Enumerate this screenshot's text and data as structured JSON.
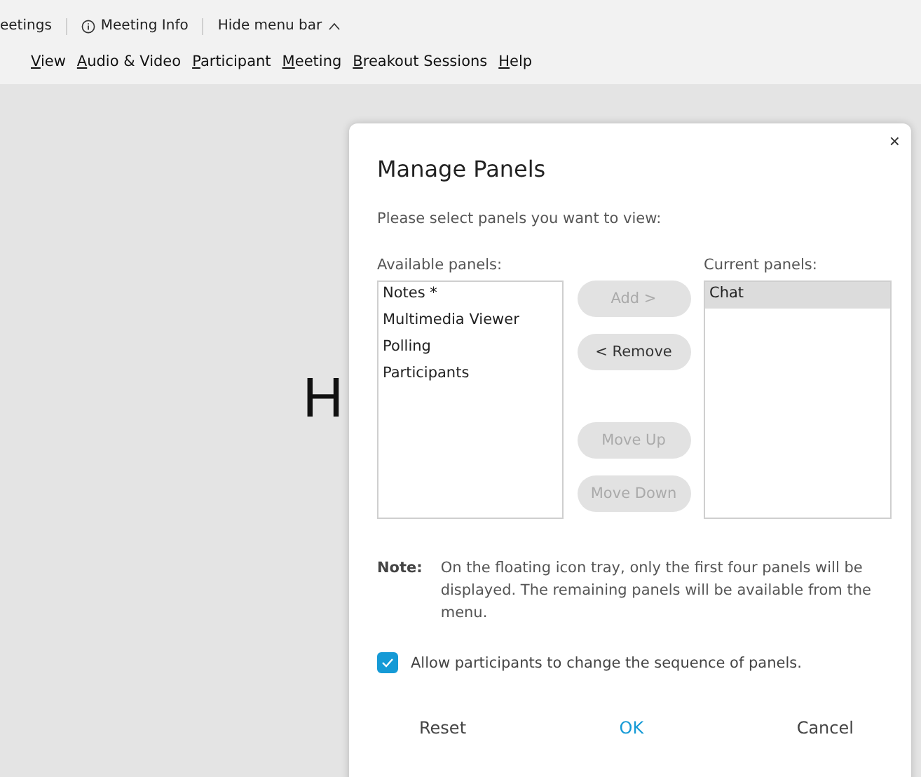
{
  "toolbar": {
    "items": [
      {
        "kind": "text",
        "label": "eetings"
      },
      {
        "kind": "info",
        "label": "Meeting Info"
      },
      {
        "kind": "caret",
        "label": "Hide menu bar"
      }
    ]
  },
  "menu": [
    "View",
    "Audio & Video",
    "Participant",
    "Meeting",
    "Breakout Sessions",
    "Help"
  ],
  "stage": {
    "title": "H"
  },
  "dialog": {
    "title": "Manage Panels",
    "close": "×",
    "instruction": "Please select panels you want to view:",
    "available": {
      "label": "Available panels:",
      "items": [
        {
          "label": "Notes *",
          "selected": false
        },
        {
          "label": "Multimedia Viewer",
          "selected": false
        },
        {
          "label": "Polling",
          "selected": false
        },
        {
          "label": "Participants",
          "selected": false
        }
      ]
    },
    "current": {
      "label": "Current panels:",
      "items": [
        {
          "label": "Chat",
          "selected": true
        }
      ]
    },
    "actions": [
      {
        "label": "Add >",
        "disabled": true
      },
      {
        "label": "< Remove",
        "disabled": false
      },
      {
        "label": "Move Up",
        "disabled": true
      },
      {
        "label": "Move Down",
        "disabled": true
      }
    ],
    "note": {
      "label": "Note:",
      "text": "On the floating icon tray, only the first four panels will be displayed. The remaining panels will be available from the menu."
    },
    "allow": {
      "label": "Allow participants to change the sequence of panels.",
      "checked": true
    },
    "footer": [
      {
        "label": "Reset",
        "primary": false
      },
      {
        "label": "OK",
        "primary": true
      },
      {
        "label": "Cancel",
        "primary": false
      }
    ]
  }
}
